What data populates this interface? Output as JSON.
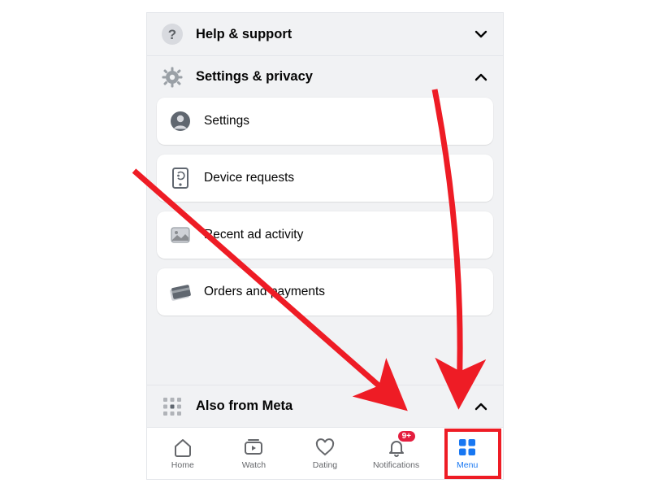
{
  "sections": {
    "help": {
      "title": "Help & support"
    },
    "settings_privacy": {
      "title": "Settings & privacy"
    },
    "also_meta": {
      "title": "Also from Meta"
    }
  },
  "cards": {
    "settings": {
      "label": "Settings"
    },
    "device_requests": {
      "label": "Device requests"
    },
    "recent_ad": {
      "label": "Recent ad activity"
    },
    "orders": {
      "label": "Orders and payments"
    }
  },
  "tabs": {
    "home": {
      "label": "Home"
    },
    "watch": {
      "label": "Watch"
    },
    "dating": {
      "label": "Dating"
    },
    "notifications": {
      "label": "Notifications",
      "badge": "9+"
    },
    "menu": {
      "label": "Menu"
    }
  },
  "colors": {
    "accent": "#1877f2",
    "highlight": "#ee1c25",
    "badge": "#e41e3f"
  }
}
